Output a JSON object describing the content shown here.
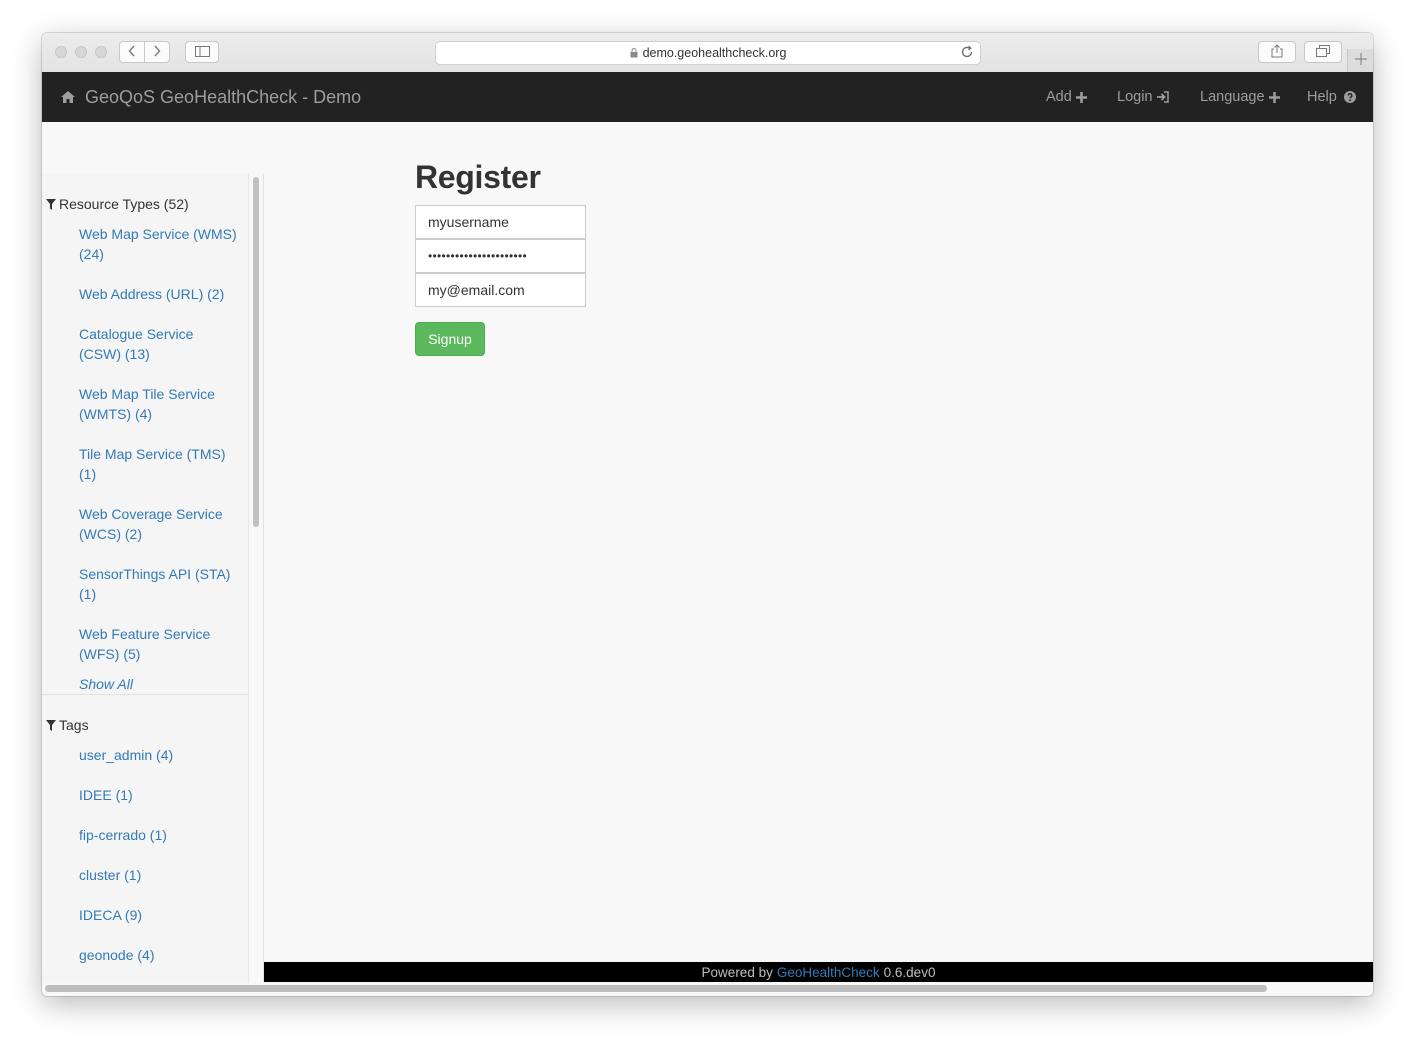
{
  "browser": {
    "url": "demo.geohealthcheck.org"
  },
  "navbar": {
    "brand": "GeoQoS GeoHealthCheck - Demo",
    "items": [
      {
        "label": "Add",
        "icon": "plus-icon"
      },
      {
        "label": "Login",
        "icon": "login-icon"
      },
      {
        "label": "Language",
        "icon": "plus-icon"
      },
      {
        "label": "Help",
        "icon": "question-circle-icon"
      }
    ]
  },
  "sidebar": {
    "resource_types": {
      "title": "Resource Types (52)",
      "items": [
        "Web Map Service (WMS) (24)",
        "Web Address (URL) (2)",
        "Catalogue Service (CSW) (13)",
        "Web Map Tile Service (WMTS) (4)",
        "Tile Map Service (TMS) (1)",
        "Web Coverage Service (WCS) (2)",
        "SensorThings API (STA) (1)",
        "Web Feature Service (WFS) (5)"
      ],
      "show_all": "Show All"
    },
    "tags": {
      "title": "Tags",
      "items": [
        "user_admin (4)",
        "IDEE (1)",
        "fip-cerrado (1)",
        "cluster (1)",
        "IDECA (9)",
        "geonode (4)"
      ]
    }
  },
  "main": {
    "title": "Register",
    "username_value": "myusername",
    "password_value": "••••••••••••••••••••••",
    "email_value": "my@email.com",
    "signup_label": "Signup"
  },
  "footer": {
    "prefix": "Powered by",
    "link": "GeoHealthCheck",
    "version": "0.6.dev0"
  },
  "colors": {
    "navbar_bg": "#222222",
    "link": "#337ab7",
    "button_success": "#5cb85c"
  }
}
